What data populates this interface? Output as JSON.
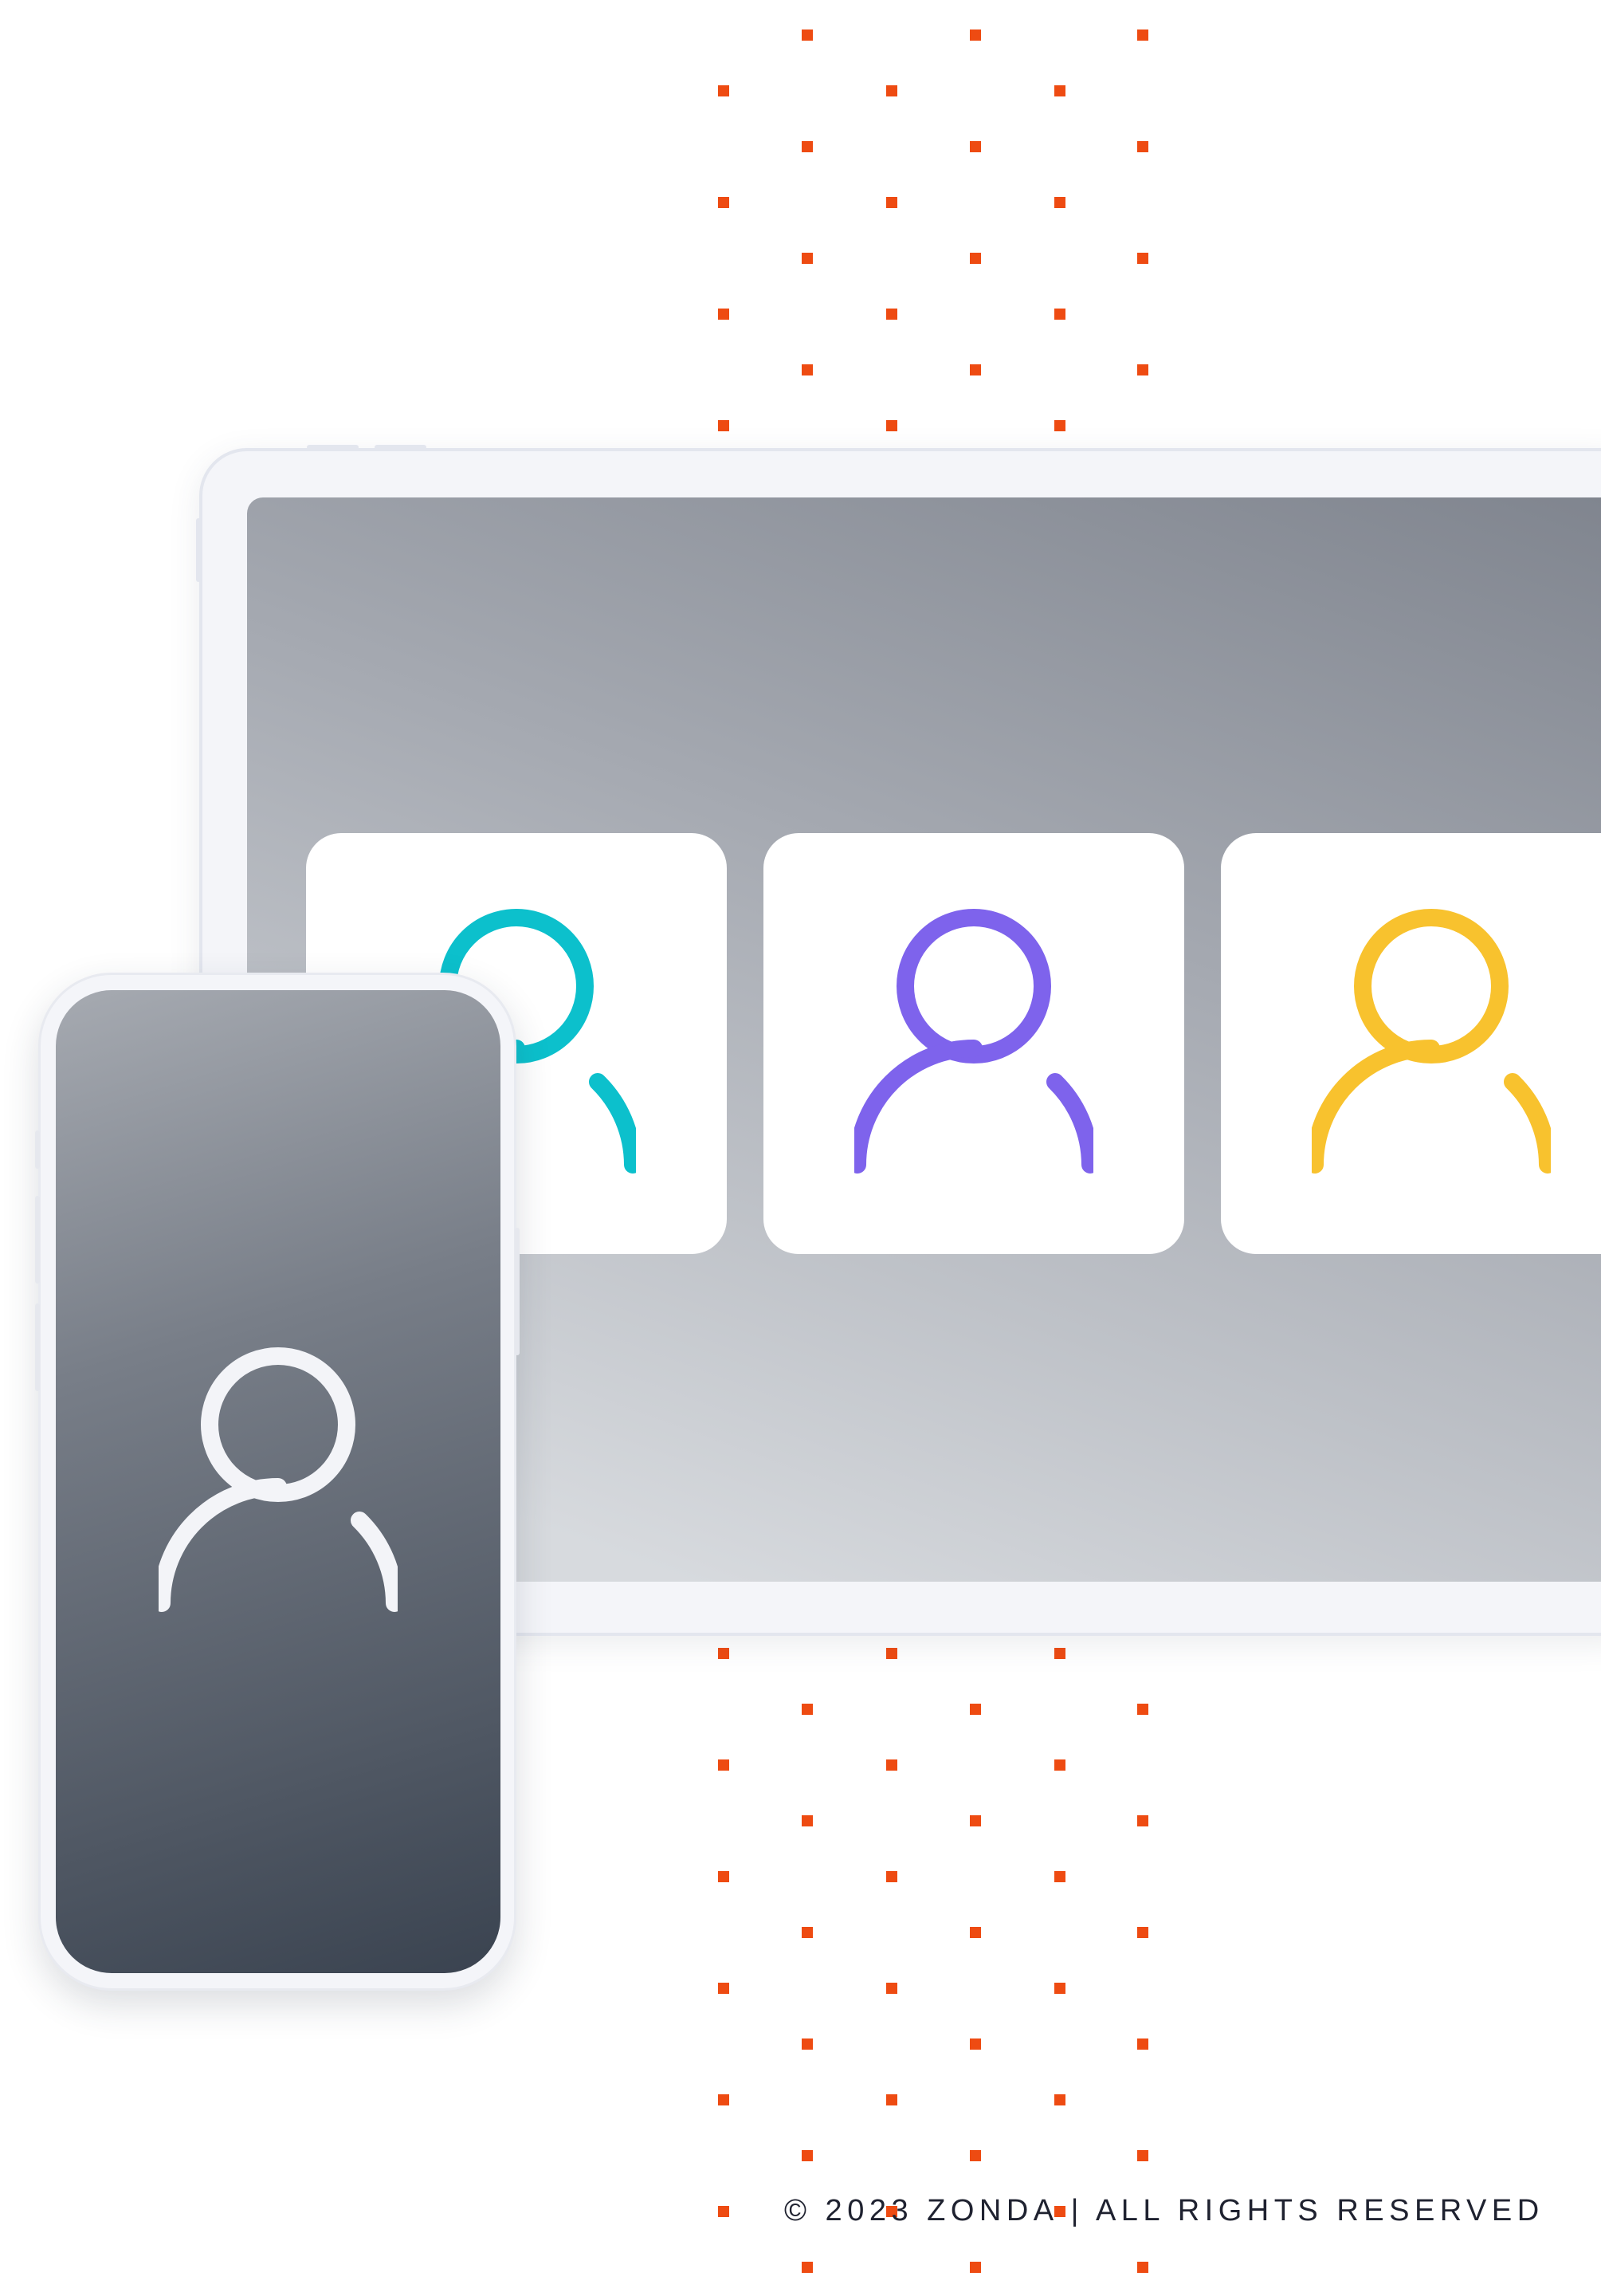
{
  "colors": {
    "accent_dots": "#ee4b12",
    "avatar_teal": "#0cc0cc",
    "avatar_purple": "#7e63ec",
    "avatar_yellow": "#f8c22e",
    "avatar_phone": "#f3f4f8"
  },
  "tablet": {
    "cards": [
      {
        "icon": "user-icon",
        "color": "#0cc0cc"
      },
      {
        "icon": "user-icon",
        "color": "#7e63ec"
      },
      {
        "icon": "user-icon",
        "color": "#f8c22e"
      }
    ]
  },
  "phone": {
    "icon": "user-icon"
  },
  "footer": {
    "copyright": "© 2023 ZONDA | ALL RIGHTS RESERVED"
  }
}
